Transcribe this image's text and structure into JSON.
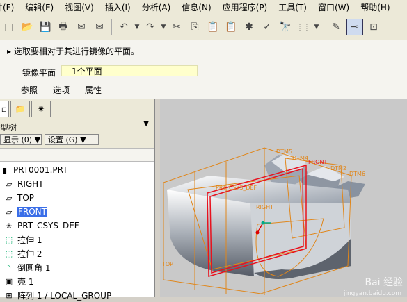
{
  "menu": [
    "件(F)",
    "编辑(E)",
    "视图(V)",
    "插入(I)",
    "分析(A)",
    "信息(N)",
    "应用程序(P)",
    "工具(T)",
    "窗口(W)",
    "帮助(H)"
  ],
  "dashboard": {
    "prompt": "选取要相对于其进行镜像的平面。",
    "mirror_plane_label": "镜像平面",
    "mirror_plane_value": "1个平面",
    "tabs": [
      "参照",
      "选项",
      "属性"
    ]
  },
  "model_tree": {
    "title": "型树",
    "show_button": "显示 (0) ▼",
    "settings_button": "设置 (G) ▼",
    "items": [
      {
        "label": "PRT0001.PRT",
        "icon": "part-icon"
      },
      {
        "label": "RIGHT",
        "icon": "datum-plane-icon"
      },
      {
        "label": "TOP",
        "icon": "datum-plane-icon"
      },
      {
        "label": "FRONT",
        "icon": "datum-plane-icon",
        "selected": true
      },
      {
        "label": "PRT_CSYS_DEF",
        "icon": "csys-icon"
      },
      {
        "label": "拉伸 1",
        "icon": "extrude-icon"
      },
      {
        "label": "拉伸 2",
        "icon": "extrude-icon"
      },
      {
        "label": "倒圆角 1",
        "icon": "round-icon"
      },
      {
        "label": "壳 1",
        "icon": "shell-icon"
      },
      {
        "label": "阵列 1 / LOCAL_GROUP",
        "icon": "pattern-icon"
      }
    ]
  },
  "viewport": {
    "datum_labels": [
      "DTM5",
      "DTM4",
      "FRONT",
      "DTM2",
      "DTM6",
      "PRT_CSYS_DEF",
      "RIGHT",
      "TOP"
    ],
    "watermark": "Bai 经验",
    "watermark_url": "jingyan.baidu.com"
  }
}
